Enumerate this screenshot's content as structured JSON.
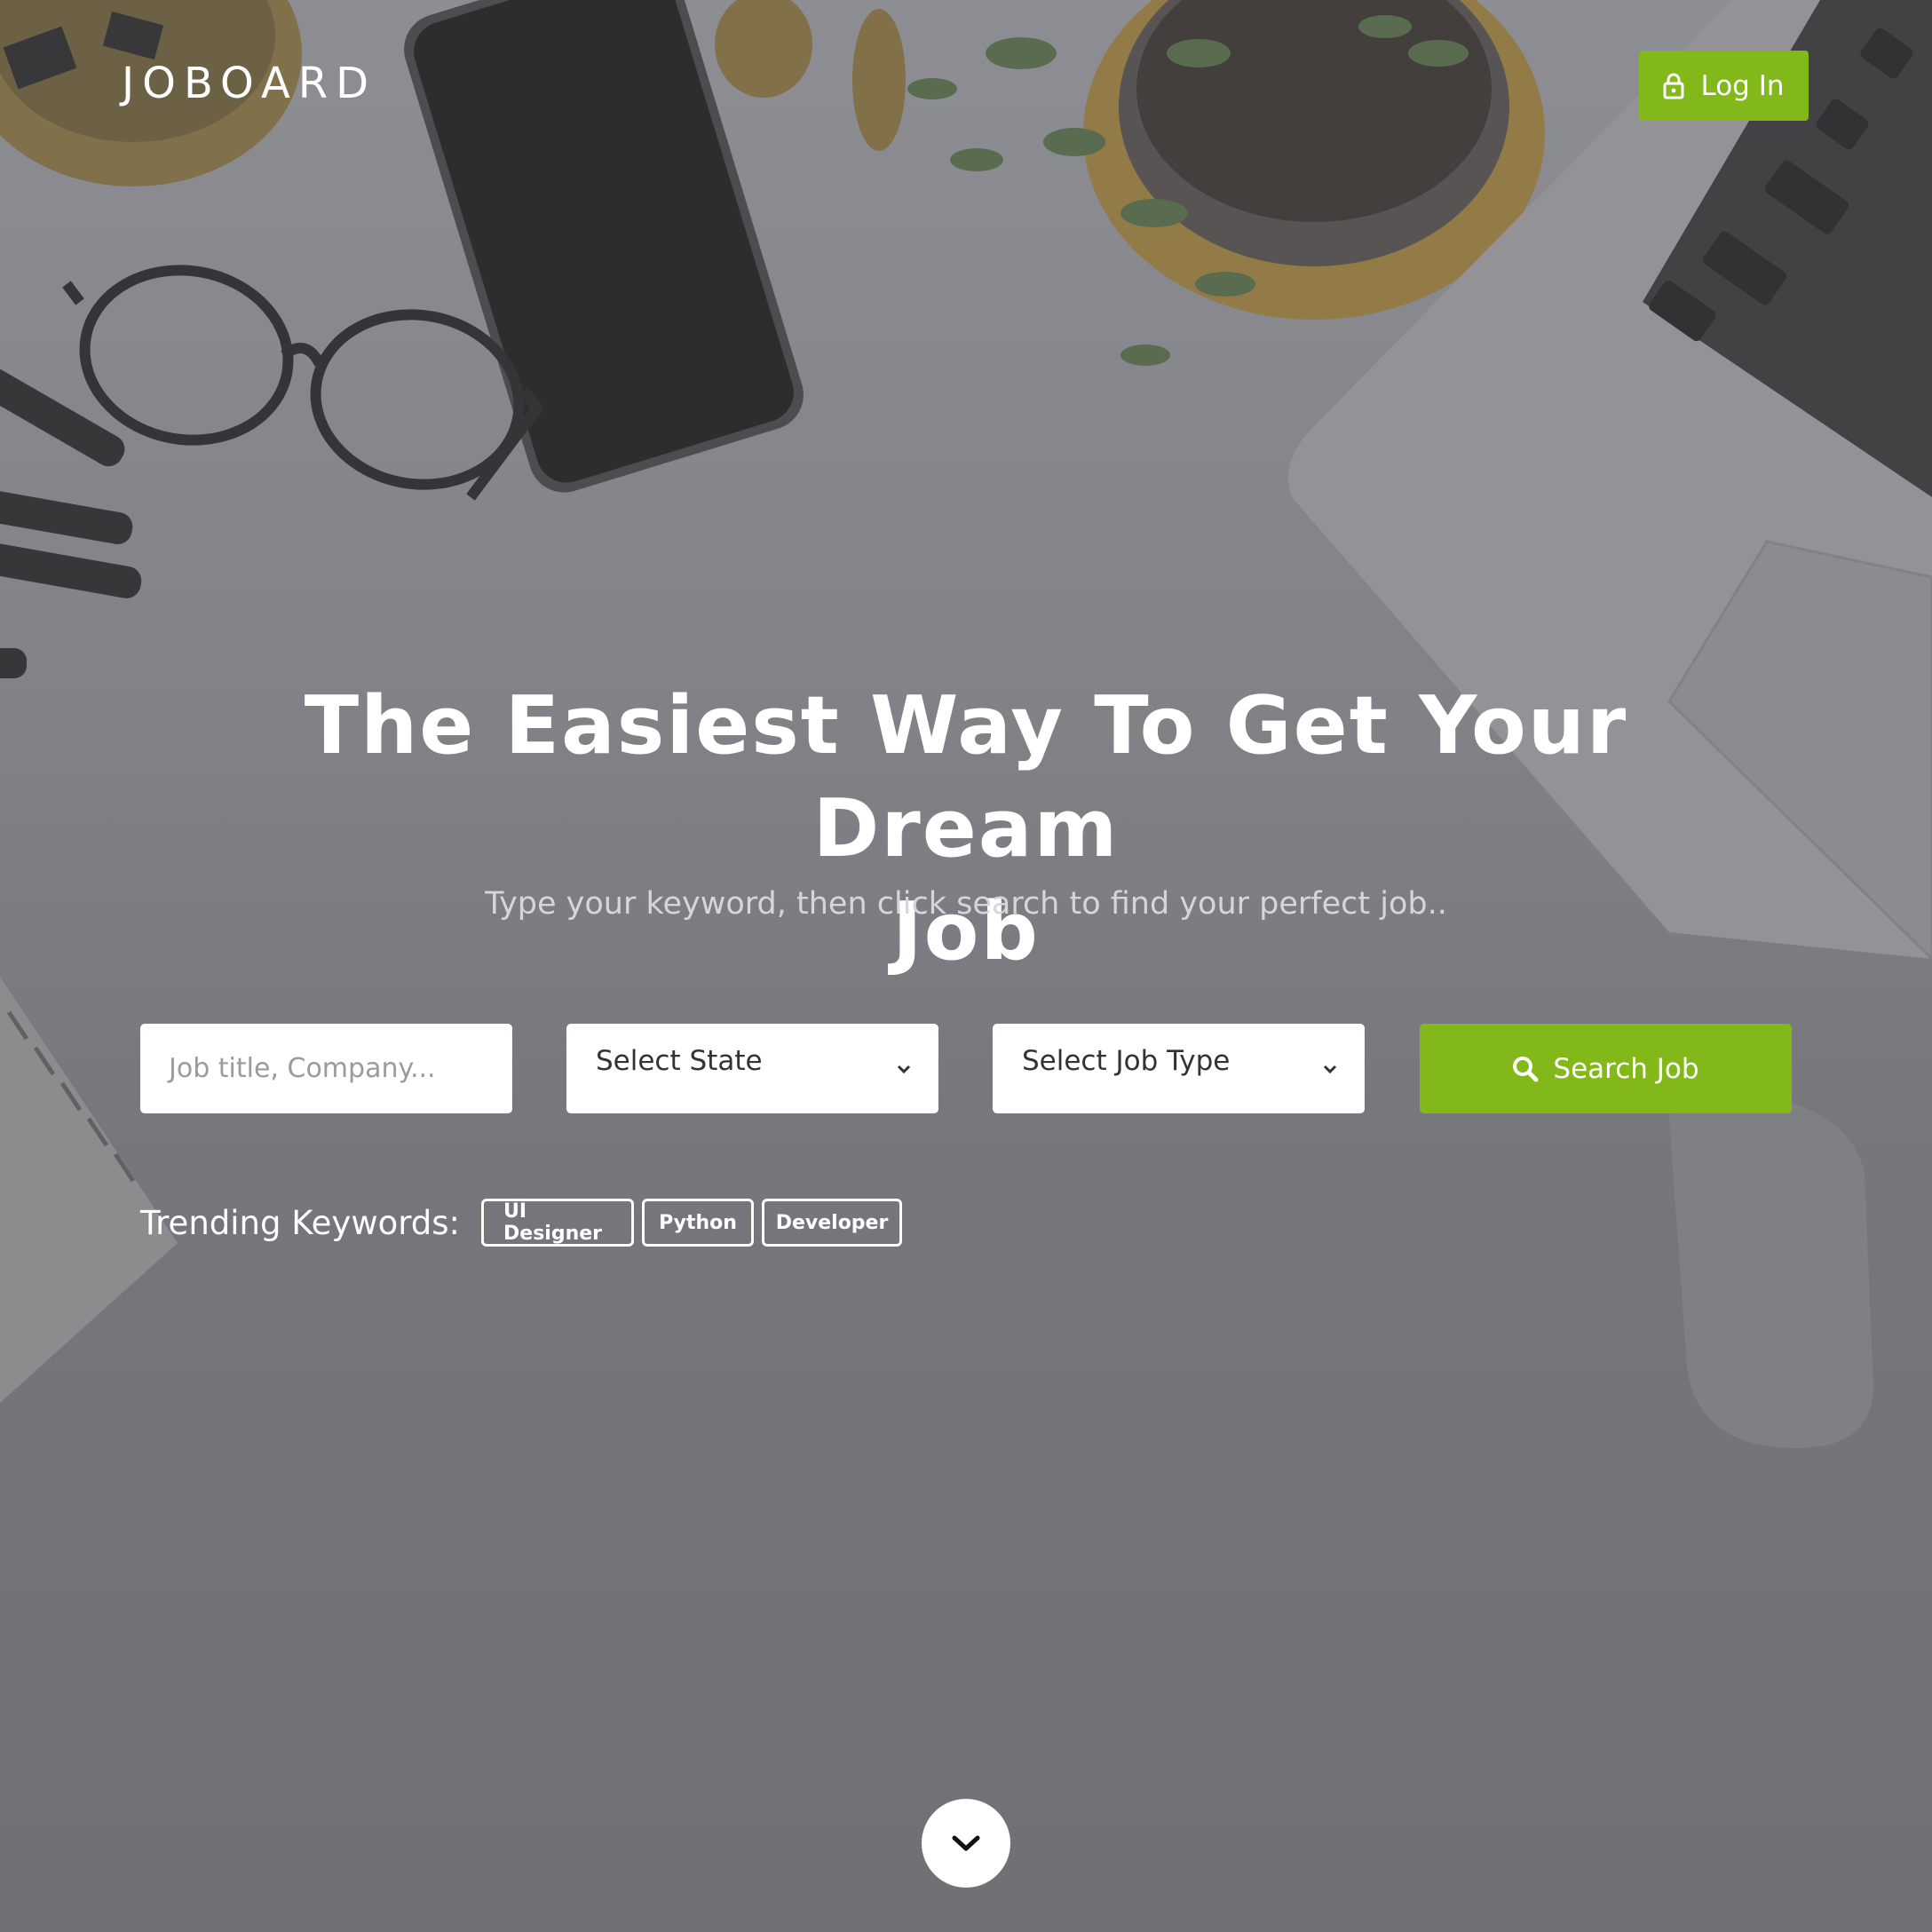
{
  "header": {
    "brand": "JOBOARD",
    "login_label": "Log In",
    "login_icon": "lock-icon"
  },
  "hero": {
    "headline_line1": "The Easiest Way To Get Your Dream",
    "headline_line2": "Job",
    "subtext": "Type your keyword, then click search to find your perfect job.."
  },
  "search": {
    "keyword_placeholder": "Job title, Company...",
    "state_selected": "Select State",
    "job_type_selected": "Select Job Type",
    "button_label": "Search Job",
    "button_icon": "search-icon"
  },
  "trending": {
    "label": "Trending Keywords:",
    "tags": [
      "UI Designer",
      "Python",
      "Developer"
    ]
  },
  "scroll_down": {
    "icon": "chevron-down-icon"
  },
  "colors": {
    "accent": "#83b81a",
    "overlay": "#7a7b7f",
    "text_light": "#ffffff"
  }
}
